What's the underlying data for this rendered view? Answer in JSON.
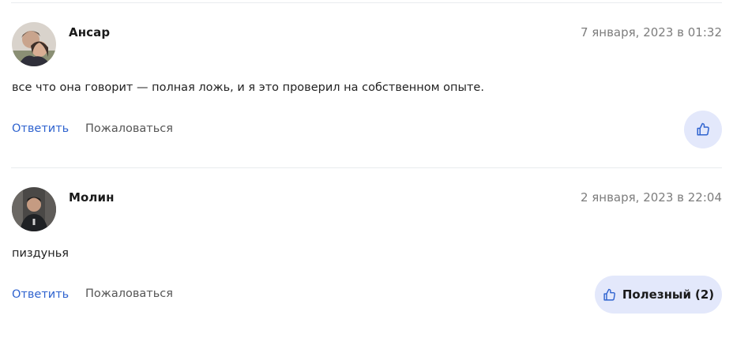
{
  "colors": {
    "accent": "#2f63cf",
    "like_bg": "#e3e8fb",
    "divider": "#e8ebee",
    "muted": "#7d7d7d"
  },
  "comments": [
    {
      "author": "Ансар",
      "date": "7 января, 2023 в 01:32",
      "text": "все что она говорит — полная ложь, и я это проверил на собственном опыте.",
      "reply_label": "Ответить",
      "report_label": "Пожаловаться",
      "like_icon": "thumbs-up-icon"
    },
    {
      "author": "Молин",
      "date": "2 января, 2023 в 22:04",
      "text": "пиздунья",
      "reply_label": "Ответить",
      "report_label": "Пожаловаться",
      "like_icon": "thumbs-up-icon",
      "like_label": "Полезный",
      "like_count": "(2)"
    }
  ]
}
